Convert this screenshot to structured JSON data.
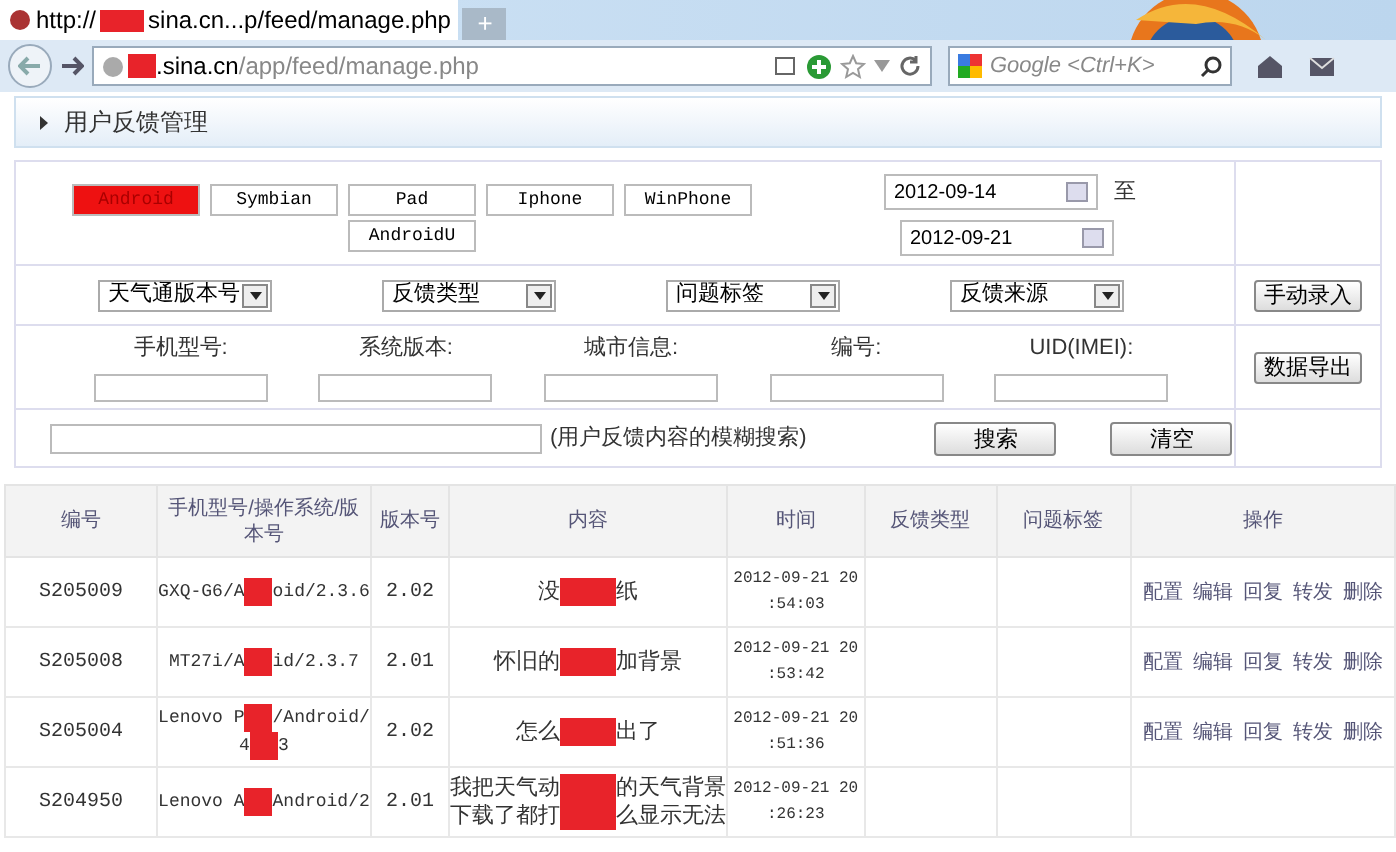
{
  "browser": {
    "tab": {
      "title_before": "http://",
      "title_after": "sina.cn...p/feed/manage.php"
    },
    "new_tab": "+",
    "address": {
      "host": ".sina.cn",
      "path": "/app/feed/manage.php"
    },
    "search": {
      "placeholder": "Google <Ctrl+K>"
    }
  },
  "section_title": "用户反馈管理",
  "platforms": [
    {
      "label": "Android",
      "selected": true
    },
    {
      "label": "Symbian",
      "selected": false
    },
    {
      "label": "Pad",
      "selected": false
    },
    {
      "label": "Iphone",
      "selected": false
    },
    {
      "label": "WinPhone",
      "selected": false
    },
    {
      "label": "AndroidU",
      "selected": false
    }
  ],
  "date_from": "2012-09-14",
  "date_sep": "至",
  "date_to": "2012-09-21",
  "selects": [
    "天气通版本号",
    "反馈类型",
    "问题标签",
    "反馈来源"
  ],
  "manual_button": "手动录入",
  "fields": [
    "手机型号:",
    "系统版本:",
    "城市信息:",
    "编号:",
    "UID(IMEI):"
  ],
  "export_button": "数据导出",
  "search_hint": "(用户反馈内容的模糊搜索)",
  "search_button": "搜索",
  "clear_button": "清空",
  "table": {
    "columns": [
      "编号",
      "手机型号/操作系统/版本号",
      "版本号",
      "内容",
      "时间",
      "反馈类型",
      "问题标签",
      "操作"
    ],
    "rows": [
      {
        "id": "S205009",
        "model": [
          [
            "GXQ-G6/A",
            "oid/2.3.6"
          ]
        ],
        "version": "2.02",
        "content": [
          [
            "没",
            "纸"
          ]
        ],
        "time": [
          "2012-09-21 20",
          ":54:03"
        ],
        "actions": [
          "配置",
          "编辑",
          "回复",
          "转发",
          "删除"
        ]
      },
      {
        "id": "S205008",
        "model": [
          [
            "MT27i/A",
            "id/2.3.7"
          ]
        ],
        "version": "2.01",
        "content": [
          [
            "怀旧的",
            "加背景"
          ]
        ],
        "time": [
          "2012-09-21 20",
          ":53:42"
        ],
        "actions": [
          "配置",
          "编辑",
          "回复",
          "转发",
          "删除"
        ]
      },
      {
        "id": "S205004",
        "model": [
          [
            "Lenovo P",
            "/Android/"
          ],
          [
            "4",
            "3"
          ]
        ],
        "version": "2.02",
        "content": [
          [
            "怎么",
            "出了"
          ]
        ],
        "time": [
          "2012-09-21 20",
          ":51:36"
        ],
        "actions": [
          "配置",
          "编辑",
          "回复",
          "转发",
          "删除"
        ]
      },
      {
        "id": "S204950",
        "model": [
          [
            "Lenovo A",
            "Android/2"
          ]
        ],
        "version": "2.01",
        "content": [
          [
            "我把天气动",
            "的天气背景"
          ],
          [
            "下载了都打",
            "么显示无法"
          ]
        ],
        "time": [
          "2012-09-21 20",
          ":26:23"
        ],
        "actions": []
      }
    ]
  }
}
